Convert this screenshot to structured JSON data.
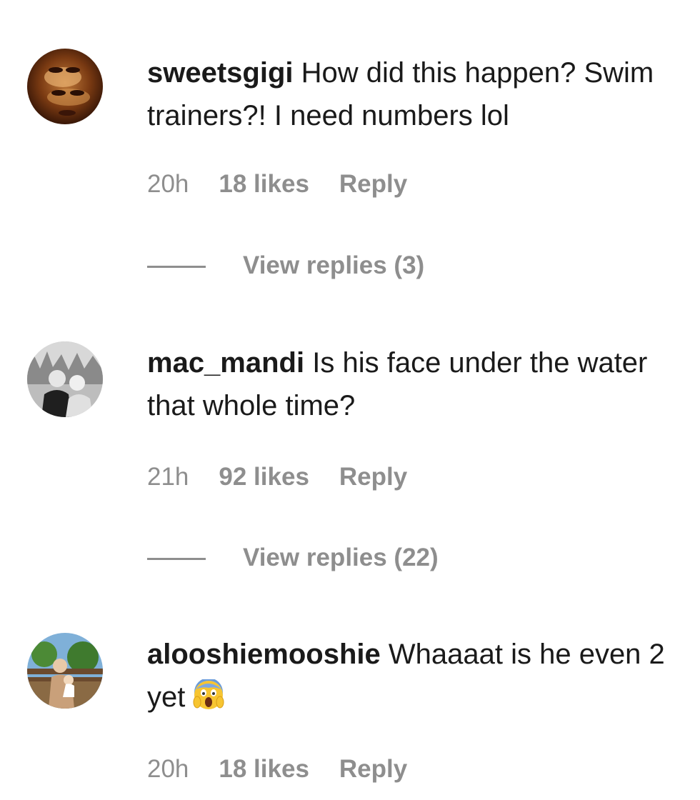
{
  "comments": [
    {
      "username": "sweetsgigi",
      "text": "How did this happen? Swim trainers?! I need numbers lol",
      "time": "20h",
      "likes": "18 likes",
      "reply": "Reply",
      "view_replies": "View replies (3)"
    },
    {
      "username": "mac_mandi",
      "text": "Is his face under the water that whole time?",
      "time": "21h",
      "likes": "92 likes",
      "reply": "Reply",
      "view_replies": "View replies (22)"
    },
    {
      "username": "alooshiemooshie",
      "text": "Whaaaat is he even 2 yet",
      "emoji": "scream-emoji",
      "time": "20h",
      "likes": "18 likes",
      "reply": "Reply"
    }
  ],
  "colors": {
    "text": "#1a1a1a",
    "meta": "#8e8e8e"
  }
}
